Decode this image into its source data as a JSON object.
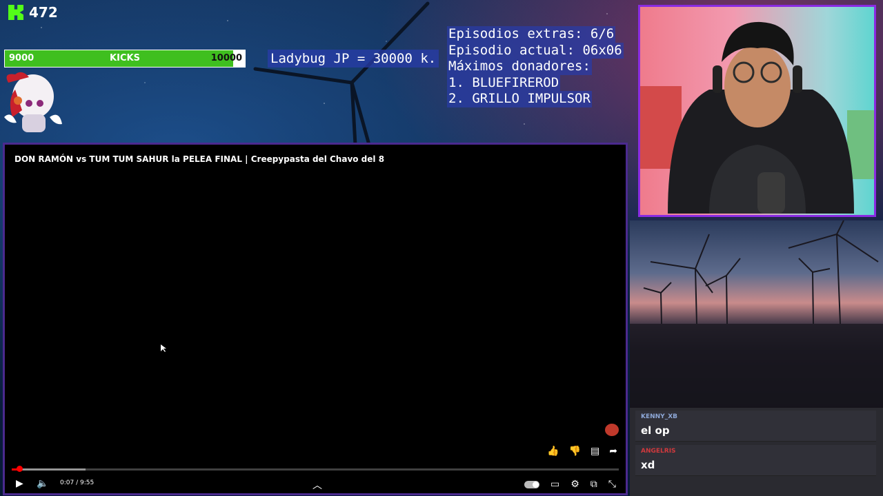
{
  "kick": {
    "count": "472",
    "logo": "kick-logo"
  },
  "goal": {
    "min": "9000",
    "label": "KICKS",
    "max": "10000",
    "progress": 0.95
  },
  "ladybug": {
    "text": "Ladybug JP = 30000 k."
  },
  "info": {
    "lines": [
      "Episodios extras: 6/6",
      "Episodio actual: 06x06",
      "Máximos donadores:",
      "1. BLUEFIREROD",
      "2. GRILLO IMPULSOR"
    ]
  },
  "player": {
    "title": "DON RAMÓN vs TUM TUM SAHUR la PELEA FINAL | Creepypasta del Chavo del 8",
    "time": "0:07 / 9:55",
    "progress": 0.012,
    "buffered": 0.122,
    "icons": {
      "like": "like-icon",
      "dislike": "dislike-icon",
      "comment": "comment-icon",
      "share": "share-icon",
      "play": "play-icon",
      "volume": "volume-icon",
      "expand": "chevron-up-icon",
      "autoplay": "autoplay-toggle",
      "captions": "captions-icon",
      "settings": "gear-icon",
      "cast": "cast-icon",
      "fullscreen": "exit-fullscreen-icon"
    }
  },
  "chat": {
    "messages": [
      {
        "user": "KENNY_XB",
        "text": "el op",
        "color": "#8ea8d8"
      },
      {
        "user": "ANGELRIS",
        "text": "xd",
        "color": "#d0393d"
      }
    ]
  }
}
